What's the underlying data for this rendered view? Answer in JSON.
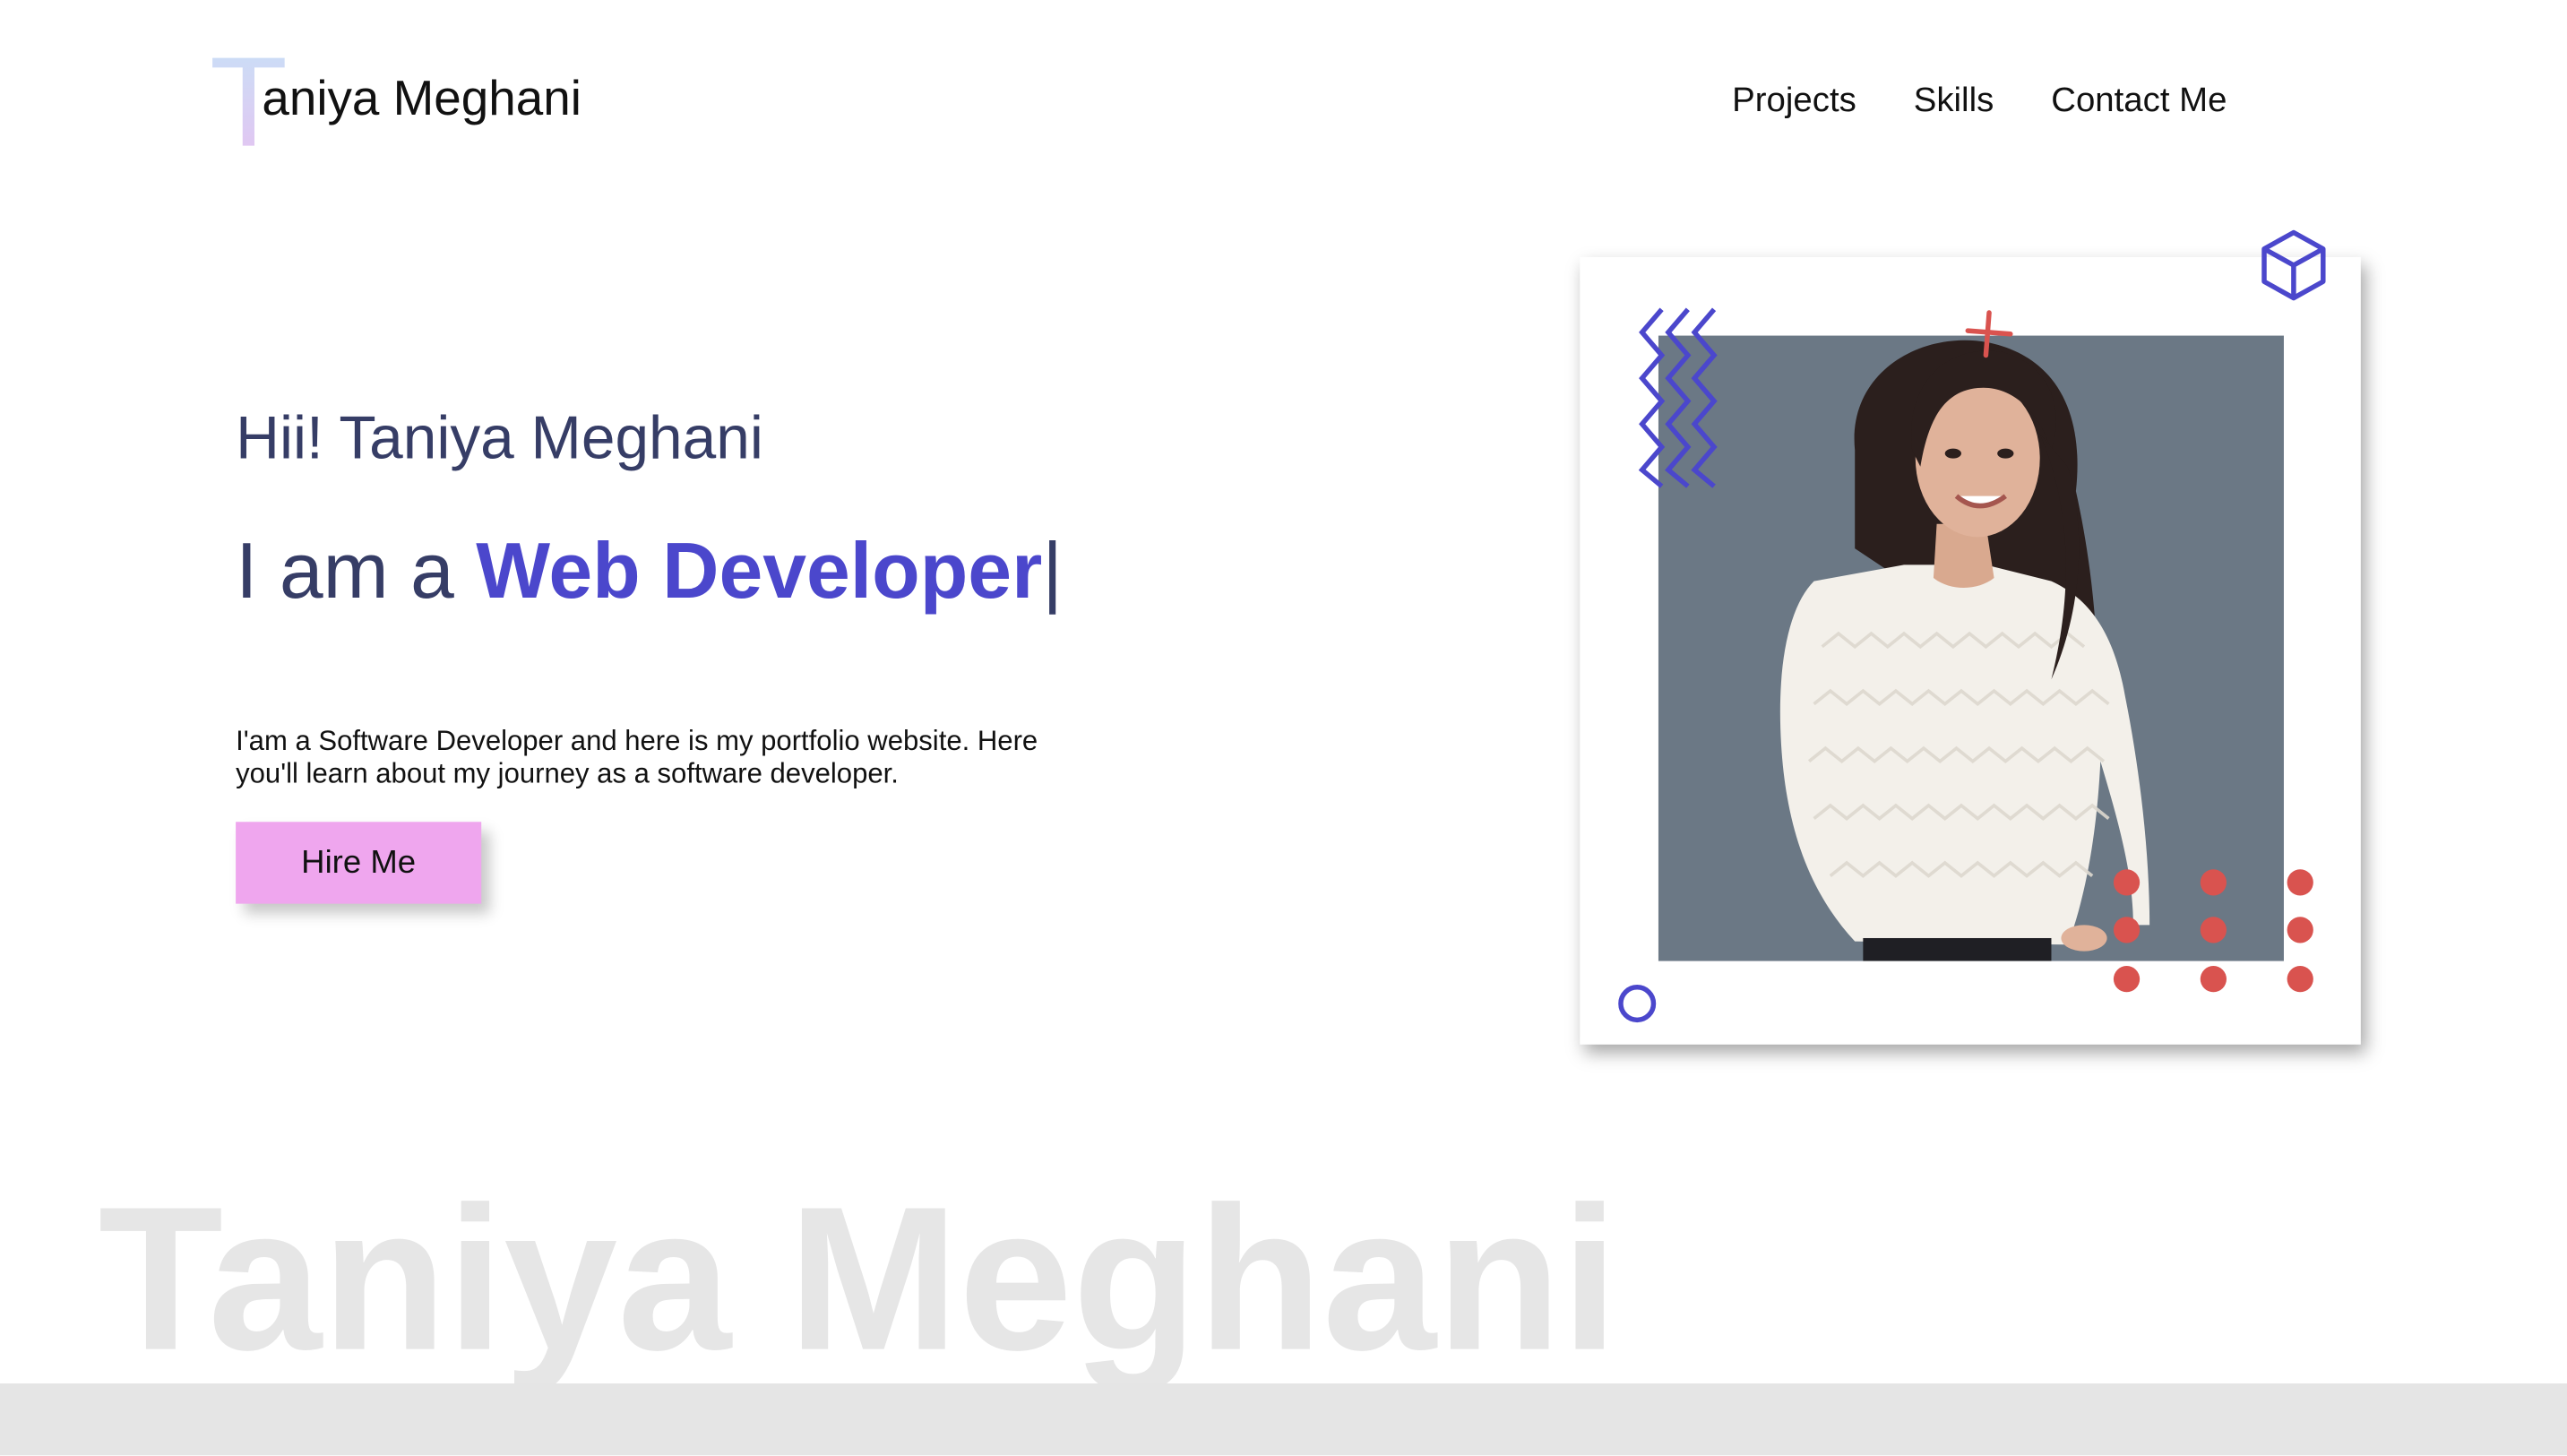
{
  "header": {
    "logo_initial": "T",
    "logo_rest": "aniya Meghani",
    "nav": [
      {
        "label": "Projects"
      },
      {
        "label": "Skills"
      },
      {
        "label": "Contact Me"
      }
    ]
  },
  "hero": {
    "greeting": "Hii! Taniya Meghani",
    "role_prefix": "I am a ",
    "role_highlight": "Web Developer",
    "cursor": "|",
    "description": "I'am a Software Developer and here is my portfolio website. Here you'll learn about my journey as a software developer.",
    "cta_label": "Hire Me"
  },
  "photo": {
    "subject": "Portrait of Taniya Meghani in a white cable-knit sweater",
    "background_color": "#6b7885"
  },
  "decor": {
    "icons": [
      "zigzag-icon",
      "plus-icon",
      "cube-icon",
      "circle-icon",
      "dot-grid-icon"
    ],
    "accent_purple": "#4b47cc",
    "accent_red": "#d9534f"
  },
  "watermark": {
    "text": "Taniya Meghani"
  },
  "colors": {
    "heading": "#363d66",
    "highlight": "#4b47cc",
    "button": "#efa6ee",
    "watermark": "#e6e6e6",
    "footer_band": "#e5e5e5"
  }
}
